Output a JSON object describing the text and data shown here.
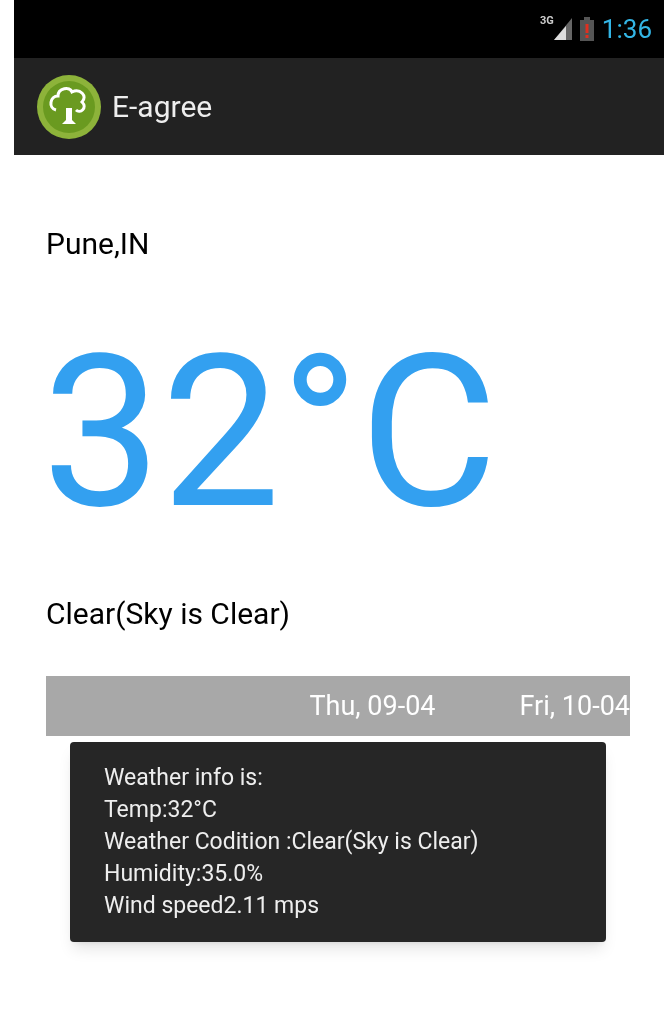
{
  "status_bar": {
    "network": "3G",
    "time": "1:36"
  },
  "app_bar": {
    "title": "E-agree"
  },
  "weather": {
    "location": "Pune,IN",
    "temperature": "32°C",
    "condition": "Clear(Sky is Clear)"
  },
  "day_tabs": [
    {
      "label": "Thu, 09-04",
      "selected": false
    },
    {
      "label": "Fri, 10-04",
      "selected": false
    }
  ],
  "toast": {
    "lines": [
      "Weather info is:",
      "Temp:32°C",
      "Weather Codition :Clear(Sky is Clear)",
      "Humidity:35.0%",
      "Wind speed2.11 mps"
    ]
  }
}
